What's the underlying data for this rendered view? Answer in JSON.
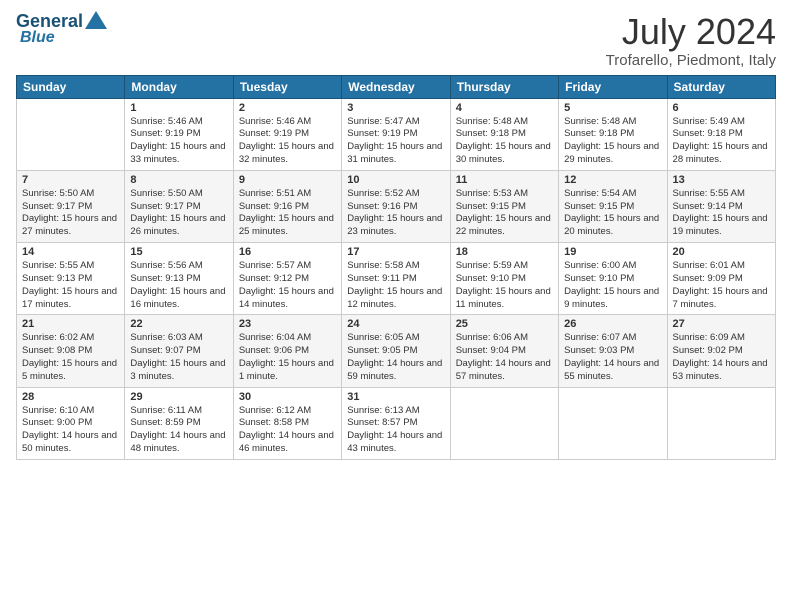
{
  "header": {
    "logo_line1": "General",
    "logo_line2": "Blue",
    "month_year": "July 2024",
    "location": "Trofarello, Piedmont, Italy"
  },
  "days_of_week": [
    "Sunday",
    "Monday",
    "Tuesday",
    "Wednesday",
    "Thursday",
    "Friday",
    "Saturday"
  ],
  "weeks": [
    [
      {
        "day": "",
        "empty": true
      },
      {
        "day": "1",
        "sunrise": "5:46 AM",
        "sunset": "9:19 PM",
        "daylight": "15 hours and 33 minutes."
      },
      {
        "day": "2",
        "sunrise": "5:46 AM",
        "sunset": "9:19 PM",
        "daylight": "15 hours and 32 minutes."
      },
      {
        "day": "3",
        "sunrise": "5:47 AM",
        "sunset": "9:19 PM",
        "daylight": "15 hours and 31 minutes."
      },
      {
        "day": "4",
        "sunrise": "5:48 AM",
        "sunset": "9:18 PM",
        "daylight": "15 hours and 30 minutes."
      },
      {
        "day": "5",
        "sunrise": "5:48 AM",
        "sunset": "9:18 PM",
        "daylight": "15 hours and 29 minutes."
      },
      {
        "day": "6",
        "sunrise": "5:49 AM",
        "sunset": "9:18 PM",
        "daylight": "15 hours and 28 minutes."
      }
    ],
    [
      {
        "day": "7",
        "sunrise": "5:50 AM",
        "sunset": "9:17 PM",
        "daylight": "15 hours and 27 minutes."
      },
      {
        "day": "8",
        "sunrise": "5:50 AM",
        "sunset": "9:17 PM",
        "daylight": "15 hours and 26 minutes."
      },
      {
        "day": "9",
        "sunrise": "5:51 AM",
        "sunset": "9:16 PM",
        "daylight": "15 hours and 25 minutes."
      },
      {
        "day": "10",
        "sunrise": "5:52 AM",
        "sunset": "9:16 PM",
        "daylight": "15 hours and 23 minutes."
      },
      {
        "day": "11",
        "sunrise": "5:53 AM",
        "sunset": "9:15 PM",
        "daylight": "15 hours and 22 minutes."
      },
      {
        "day": "12",
        "sunrise": "5:54 AM",
        "sunset": "9:15 PM",
        "daylight": "15 hours and 20 minutes."
      },
      {
        "day": "13",
        "sunrise": "5:55 AM",
        "sunset": "9:14 PM",
        "daylight": "15 hours and 19 minutes."
      }
    ],
    [
      {
        "day": "14",
        "sunrise": "5:55 AM",
        "sunset": "9:13 PM",
        "daylight": "15 hours and 17 minutes."
      },
      {
        "day": "15",
        "sunrise": "5:56 AM",
        "sunset": "9:13 PM",
        "daylight": "15 hours and 16 minutes."
      },
      {
        "day": "16",
        "sunrise": "5:57 AM",
        "sunset": "9:12 PM",
        "daylight": "15 hours and 14 minutes."
      },
      {
        "day": "17",
        "sunrise": "5:58 AM",
        "sunset": "9:11 PM",
        "daylight": "15 hours and 12 minutes."
      },
      {
        "day": "18",
        "sunrise": "5:59 AM",
        "sunset": "9:10 PM",
        "daylight": "15 hours and 11 minutes."
      },
      {
        "day": "19",
        "sunrise": "6:00 AM",
        "sunset": "9:10 PM",
        "daylight": "15 hours and 9 minutes."
      },
      {
        "day": "20",
        "sunrise": "6:01 AM",
        "sunset": "9:09 PM",
        "daylight": "15 hours and 7 minutes."
      }
    ],
    [
      {
        "day": "21",
        "sunrise": "6:02 AM",
        "sunset": "9:08 PM",
        "daylight": "15 hours and 5 minutes."
      },
      {
        "day": "22",
        "sunrise": "6:03 AM",
        "sunset": "9:07 PM",
        "daylight": "15 hours and 3 minutes."
      },
      {
        "day": "23",
        "sunrise": "6:04 AM",
        "sunset": "9:06 PM",
        "daylight": "15 hours and 1 minute."
      },
      {
        "day": "24",
        "sunrise": "6:05 AM",
        "sunset": "9:05 PM",
        "daylight": "14 hours and 59 minutes."
      },
      {
        "day": "25",
        "sunrise": "6:06 AM",
        "sunset": "9:04 PM",
        "daylight": "14 hours and 57 minutes."
      },
      {
        "day": "26",
        "sunrise": "6:07 AM",
        "sunset": "9:03 PM",
        "daylight": "14 hours and 55 minutes."
      },
      {
        "day": "27",
        "sunrise": "6:09 AM",
        "sunset": "9:02 PM",
        "daylight": "14 hours and 53 minutes."
      }
    ],
    [
      {
        "day": "28",
        "sunrise": "6:10 AM",
        "sunset": "9:00 PM",
        "daylight": "14 hours and 50 minutes."
      },
      {
        "day": "29",
        "sunrise": "6:11 AM",
        "sunset": "8:59 PM",
        "daylight": "14 hours and 48 minutes."
      },
      {
        "day": "30",
        "sunrise": "6:12 AM",
        "sunset": "8:58 PM",
        "daylight": "14 hours and 46 minutes."
      },
      {
        "day": "31",
        "sunrise": "6:13 AM",
        "sunset": "8:57 PM",
        "daylight": "14 hours and 43 minutes."
      },
      {
        "day": "",
        "empty": true
      },
      {
        "day": "",
        "empty": true
      },
      {
        "day": "",
        "empty": true
      }
    ]
  ],
  "labels": {
    "sunrise": "Sunrise:",
    "sunset": "Sunset:",
    "daylight": "Daylight:"
  }
}
